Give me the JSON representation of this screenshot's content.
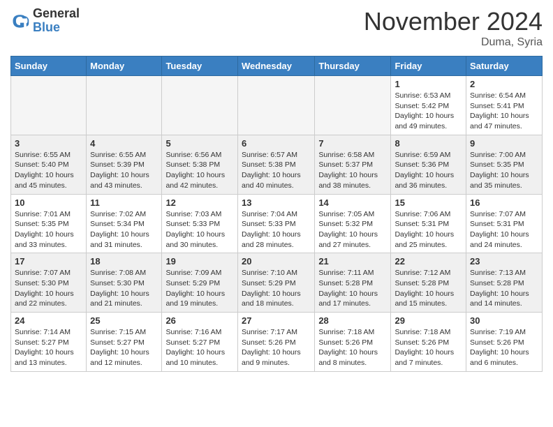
{
  "header": {
    "logo_line1": "General",
    "logo_line2": "Blue",
    "month": "November 2024",
    "location": "Duma, Syria"
  },
  "weekdays": [
    "Sunday",
    "Monday",
    "Tuesday",
    "Wednesday",
    "Thursday",
    "Friday",
    "Saturday"
  ],
  "weeks": [
    [
      {
        "day": "",
        "detail": ""
      },
      {
        "day": "",
        "detail": ""
      },
      {
        "day": "",
        "detail": ""
      },
      {
        "day": "",
        "detail": ""
      },
      {
        "day": "",
        "detail": ""
      },
      {
        "day": "1",
        "detail": "Sunrise: 6:53 AM\nSunset: 5:42 PM\nDaylight: 10 hours\nand 49 minutes."
      },
      {
        "day": "2",
        "detail": "Sunrise: 6:54 AM\nSunset: 5:41 PM\nDaylight: 10 hours\nand 47 minutes."
      }
    ],
    [
      {
        "day": "3",
        "detail": "Sunrise: 6:55 AM\nSunset: 5:40 PM\nDaylight: 10 hours\nand 45 minutes."
      },
      {
        "day": "4",
        "detail": "Sunrise: 6:55 AM\nSunset: 5:39 PM\nDaylight: 10 hours\nand 43 minutes."
      },
      {
        "day": "5",
        "detail": "Sunrise: 6:56 AM\nSunset: 5:38 PM\nDaylight: 10 hours\nand 42 minutes."
      },
      {
        "day": "6",
        "detail": "Sunrise: 6:57 AM\nSunset: 5:38 PM\nDaylight: 10 hours\nand 40 minutes."
      },
      {
        "day": "7",
        "detail": "Sunrise: 6:58 AM\nSunset: 5:37 PM\nDaylight: 10 hours\nand 38 minutes."
      },
      {
        "day": "8",
        "detail": "Sunrise: 6:59 AM\nSunset: 5:36 PM\nDaylight: 10 hours\nand 36 minutes."
      },
      {
        "day": "9",
        "detail": "Sunrise: 7:00 AM\nSunset: 5:35 PM\nDaylight: 10 hours\nand 35 minutes."
      }
    ],
    [
      {
        "day": "10",
        "detail": "Sunrise: 7:01 AM\nSunset: 5:35 PM\nDaylight: 10 hours\nand 33 minutes."
      },
      {
        "day": "11",
        "detail": "Sunrise: 7:02 AM\nSunset: 5:34 PM\nDaylight: 10 hours\nand 31 minutes."
      },
      {
        "day": "12",
        "detail": "Sunrise: 7:03 AM\nSunset: 5:33 PM\nDaylight: 10 hours\nand 30 minutes."
      },
      {
        "day": "13",
        "detail": "Sunrise: 7:04 AM\nSunset: 5:33 PM\nDaylight: 10 hours\nand 28 minutes."
      },
      {
        "day": "14",
        "detail": "Sunrise: 7:05 AM\nSunset: 5:32 PM\nDaylight: 10 hours\nand 27 minutes."
      },
      {
        "day": "15",
        "detail": "Sunrise: 7:06 AM\nSunset: 5:31 PM\nDaylight: 10 hours\nand 25 minutes."
      },
      {
        "day": "16",
        "detail": "Sunrise: 7:07 AM\nSunset: 5:31 PM\nDaylight: 10 hours\nand 24 minutes."
      }
    ],
    [
      {
        "day": "17",
        "detail": "Sunrise: 7:07 AM\nSunset: 5:30 PM\nDaylight: 10 hours\nand 22 minutes."
      },
      {
        "day": "18",
        "detail": "Sunrise: 7:08 AM\nSunset: 5:30 PM\nDaylight: 10 hours\nand 21 minutes."
      },
      {
        "day": "19",
        "detail": "Sunrise: 7:09 AM\nSunset: 5:29 PM\nDaylight: 10 hours\nand 19 minutes."
      },
      {
        "day": "20",
        "detail": "Sunrise: 7:10 AM\nSunset: 5:29 PM\nDaylight: 10 hours\nand 18 minutes."
      },
      {
        "day": "21",
        "detail": "Sunrise: 7:11 AM\nSunset: 5:28 PM\nDaylight: 10 hours\nand 17 minutes."
      },
      {
        "day": "22",
        "detail": "Sunrise: 7:12 AM\nSunset: 5:28 PM\nDaylight: 10 hours\nand 15 minutes."
      },
      {
        "day": "23",
        "detail": "Sunrise: 7:13 AM\nSunset: 5:28 PM\nDaylight: 10 hours\nand 14 minutes."
      }
    ],
    [
      {
        "day": "24",
        "detail": "Sunrise: 7:14 AM\nSunset: 5:27 PM\nDaylight: 10 hours\nand 13 minutes."
      },
      {
        "day": "25",
        "detail": "Sunrise: 7:15 AM\nSunset: 5:27 PM\nDaylight: 10 hours\nand 12 minutes."
      },
      {
        "day": "26",
        "detail": "Sunrise: 7:16 AM\nSunset: 5:27 PM\nDaylight: 10 hours\nand 10 minutes."
      },
      {
        "day": "27",
        "detail": "Sunrise: 7:17 AM\nSunset: 5:26 PM\nDaylight: 10 hours\nand 9 minutes."
      },
      {
        "day": "28",
        "detail": "Sunrise: 7:18 AM\nSunset: 5:26 PM\nDaylight: 10 hours\nand 8 minutes."
      },
      {
        "day": "29",
        "detail": "Sunrise: 7:18 AM\nSunset: 5:26 PM\nDaylight: 10 hours\nand 7 minutes."
      },
      {
        "day": "30",
        "detail": "Sunrise: 7:19 AM\nSunset: 5:26 PM\nDaylight: 10 hours\nand 6 minutes."
      }
    ]
  ]
}
